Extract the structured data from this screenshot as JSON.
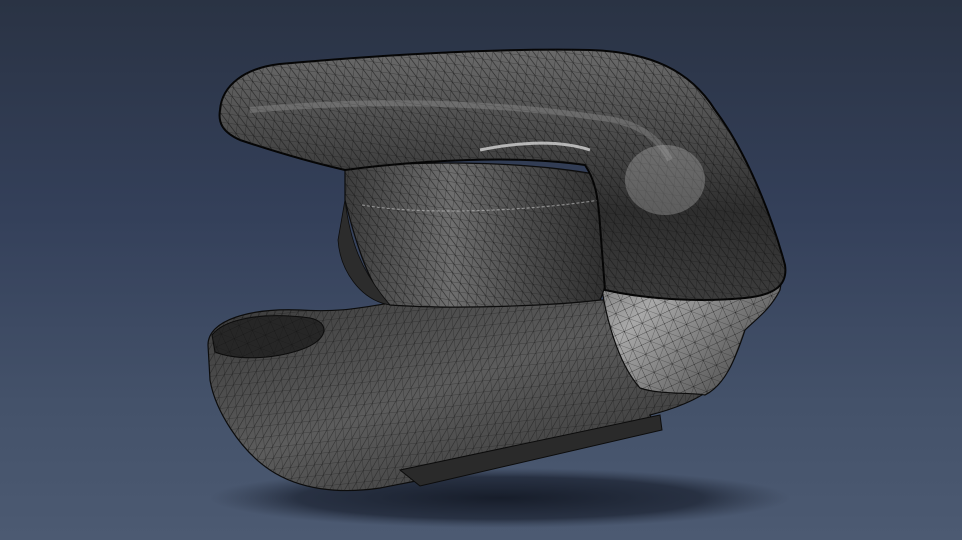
{
  "viewport": {
    "background_top": "#2a3344",
    "background_bottom": "#4c5a72"
  },
  "model": {
    "render_mode": "shaded-wireframe",
    "mesh_fill": "#4a4a4a",
    "mesh_line": "#151515",
    "highlight": "#c8c8c8",
    "shadow": "#1e2533"
  }
}
